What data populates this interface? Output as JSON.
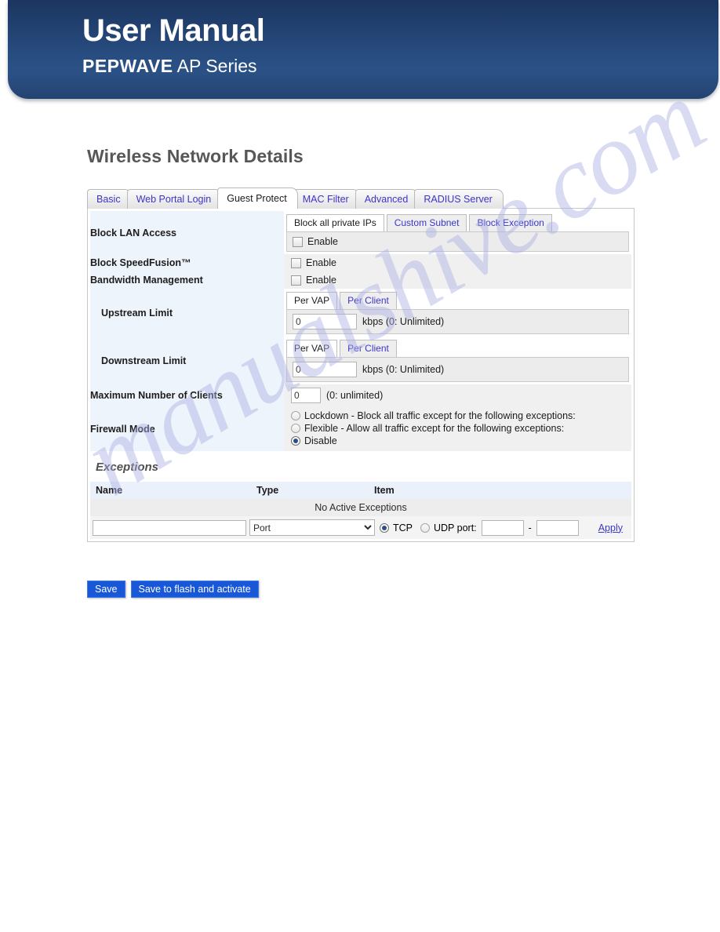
{
  "banner": {
    "title": "User Manual",
    "brand": "PEPWAVE",
    "series": " AP Series"
  },
  "page": {
    "title": "Wireless Network Details",
    "watermark": "manualshive.com"
  },
  "tabs": [
    {
      "label": "Basic",
      "active": false
    },
    {
      "label": "Web Portal Login",
      "active": false
    },
    {
      "label": "Guest Protect",
      "active": true
    },
    {
      "label": "MAC Filter",
      "active": false
    },
    {
      "label": "Advanced",
      "active": false
    },
    {
      "label": "RADIUS Server",
      "active": false
    }
  ],
  "form": {
    "block_lan_access": {
      "label": "Block LAN Access",
      "subtabs": [
        {
          "label": "Block all private IPs",
          "active": true
        },
        {
          "label": "Custom Subnet",
          "active": false
        },
        {
          "label": "Block Exception",
          "active": false
        }
      ],
      "enable_label": "Enable",
      "enable_checked": false
    },
    "block_speedfusion": {
      "label": "Block SpeedFusion™",
      "enable_label": "Enable",
      "enable_checked": false
    },
    "bandwidth_management": {
      "label": "Bandwidth Management",
      "enable_label": "Enable",
      "enable_checked": false
    },
    "upstream_limit": {
      "label": "Upstream Limit",
      "subtabs": [
        {
          "label": "Per VAP",
          "active": true
        },
        {
          "label": "Per Client",
          "active": false
        }
      ],
      "value": "0",
      "unit": "kbps (0: Unlimited)"
    },
    "downstream_limit": {
      "label": "Downstream Limit",
      "subtabs": [
        {
          "label": "Per VAP",
          "active": true
        },
        {
          "label": "Per Client",
          "active": false
        }
      ],
      "value": "0",
      "unit": "kbps (0: Unlimited)"
    },
    "max_clients": {
      "label": "Maximum Number of Clients",
      "value": "0",
      "unit": "(0: unlimited)"
    },
    "firewall_mode": {
      "label": "Firewall Mode",
      "options": [
        {
          "label": "Lockdown - Block all traffic except for the following exceptions:",
          "selected": false
        },
        {
          "label": "Flexible - Allow all traffic except for the following exceptions:",
          "selected": false
        },
        {
          "label": "Disable",
          "selected": true
        }
      ]
    }
  },
  "exceptions": {
    "title": "Exceptions",
    "columns": [
      "Name",
      "Type",
      "Item"
    ],
    "empty_message": "No Active Exceptions",
    "add_row": {
      "name_value": "",
      "type_selected": "Port",
      "type_options": [
        "Port"
      ],
      "protocol": [
        {
          "label": "TCP",
          "selected": true
        },
        {
          "label": "UDP port:",
          "selected": false
        }
      ],
      "port_from": "",
      "port_dash": "-",
      "port_to": "",
      "apply_label": "Apply"
    }
  },
  "buttons": {
    "save": "Save",
    "save_flash": "Save to flash and activate"
  },
  "colors": {
    "banner_dark": "#1c3560",
    "banner_light": "#2a5186",
    "link": "#3b36c8",
    "button_blue": "#1757d8",
    "label_bg": "#eef4fb",
    "watermark": "#aab0e4"
  }
}
